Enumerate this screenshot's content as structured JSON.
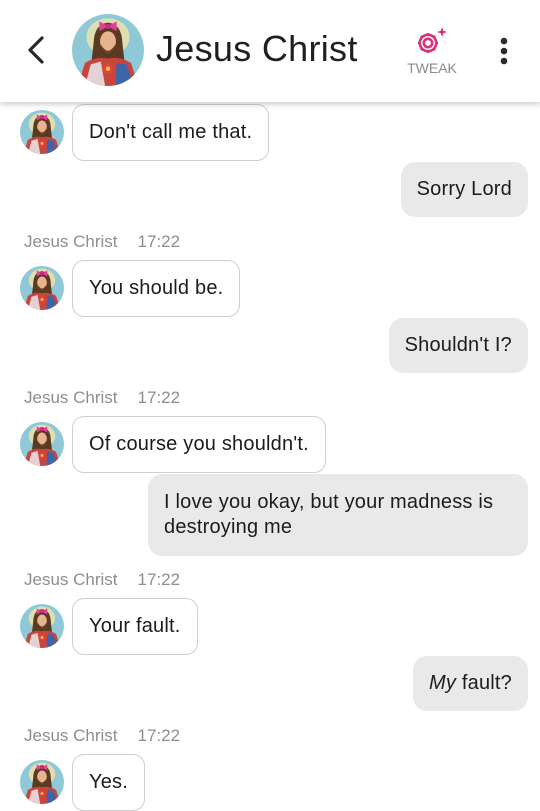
{
  "header": {
    "back_icon": "chevron-left-icon",
    "contact_name": "Jesus Christ",
    "tweak_label": "TWEAK",
    "tweak_icon": "gear-sparkle-icon",
    "tweak_color": "#d6337a",
    "menu_icon": "more-vertical-icon"
  },
  "conversation": {
    "sender_name": "Jesus Christ",
    "time": "17:22",
    "messages": [
      {
        "from": "them",
        "text": "Don't call me that."
      },
      {
        "from": "me",
        "text": "Sorry Lord"
      },
      {
        "from": "them",
        "text": "You should be."
      },
      {
        "from": "me",
        "text": "Shouldn't I?"
      },
      {
        "from": "them",
        "text": "Of course you shouldn't."
      },
      {
        "from": "me",
        "text": "I love you okay, but your madness is destroying me"
      },
      {
        "from": "them",
        "text": "Your fault."
      },
      {
        "from": "me",
        "emphasis": "My",
        "text": " fault?"
      },
      {
        "from": "them",
        "text": "Yes."
      }
    ]
  },
  "colors": {
    "incoming_bubble": "#ffffff",
    "outgoing_bubble": "#e9e9e9",
    "avatar_background": "#8fc9d8",
    "bow": "#e63f9b"
  }
}
